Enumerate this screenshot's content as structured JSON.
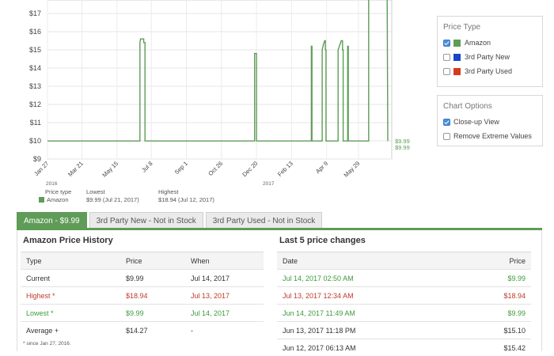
{
  "chart_data": {
    "type": "line",
    "x_start": "2016-01-27",
    "ylim": [
      9,
      17
    ],
    "yticks": [
      "$9",
      "$10",
      "$11",
      "$12",
      "$13",
      "$14",
      "$15",
      "$16",
      "$17"
    ],
    "xticks": [
      {
        "label": "Jan 27",
        "date": "2016-01-27"
      },
      {
        "label": "Mar 21",
        "date": "2016-03-21"
      },
      {
        "label": "May 15",
        "date": "2016-05-15"
      },
      {
        "label": "Jul 8",
        "date": "2016-07-08"
      },
      {
        "label": "Sep 1",
        "date": "2016-09-01"
      },
      {
        "label": "Oct 26",
        "date": "2016-10-26"
      },
      {
        "label": "Dec 20",
        "date": "2016-12-20"
      },
      {
        "label": "Feb 13",
        "date": "2017-02-13"
      },
      {
        "label": "Apr 9",
        "date": "2017-04-09"
      },
      {
        "label": "May 29",
        "date": "2017-05-29"
      }
    ],
    "year_labels": [
      {
        "label": "2016",
        "date": "2016-01-27"
      },
      {
        "label": "2017",
        "date": "2017-01-01"
      }
    ],
    "series": [
      {
        "name": "Amazon",
        "color": "#5e9c57",
        "points": [
          [
            "2016-01-27",
            9.99
          ],
          [
            "2016-06-20",
            9.99
          ],
          [
            "2016-06-20",
            15.4
          ],
          [
            "2016-06-21",
            15.6
          ],
          [
            "2016-06-26",
            15.6
          ],
          [
            "2016-06-26",
            15.4
          ],
          [
            "2016-06-28",
            15.4
          ],
          [
            "2016-06-28",
            9.99
          ],
          [
            "2016-12-17",
            9.99
          ],
          [
            "2016-12-17",
            14.8
          ],
          [
            "2016-12-20",
            14.8
          ],
          [
            "2016-12-20",
            9.99
          ],
          [
            "2017-03-16",
            9.99
          ],
          [
            "2017-03-16",
            15.2
          ],
          [
            "2017-03-17",
            15.2
          ],
          [
            "2017-03-17",
            9.99
          ],
          [
            "2017-04-02",
            9.99
          ],
          [
            "2017-04-02",
            15.0
          ],
          [
            "2017-04-04",
            15.3
          ],
          [
            "2017-04-06",
            15.5
          ],
          [
            "2017-04-07",
            15.5
          ],
          [
            "2017-04-07",
            15.0
          ],
          [
            "2017-04-08",
            15.0
          ],
          [
            "2017-04-08",
            9.99
          ],
          [
            "2017-04-27",
            9.99
          ],
          [
            "2017-04-27",
            15.0
          ],
          [
            "2017-04-29",
            15.2
          ],
          [
            "2017-05-02",
            15.5
          ],
          [
            "2017-05-04",
            15.5
          ],
          [
            "2017-05-04",
            15.0
          ],
          [
            "2017-05-05",
            15.0
          ],
          [
            "2017-05-05",
            9.99
          ],
          [
            "2017-05-12",
            9.99
          ],
          [
            "2017-05-12",
            15.2
          ],
          [
            "2017-05-13",
            15.2
          ],
          [
            "2017-05-13",
            9.99
          ],
          [
            "2017-06-14",
            9.99
          ],
          [
            "2017-06-14",
            18.94
          ],
          [
            "2017-07-13",
            18.94
          ],
          [
            "2017-07-14",
            9.99
          ],
          [
            "2017-07-14",
            9.99
          ]
        ]
      }
    ],
    "end_labels": [
      "$9.99",
      "$9.99"
    ]
  },
  "price_type": {
    "title": "Price Type",
    "options": [
      {
        "label": "Amazon",
        "checked": true,
        "color": "#5e9c57"
      },
      {
        "label": "3rd Party New",
        "checked": false,
        "color": "#1a44c8"
      },
      {
        "label": "3rd Party Used",
        "checked": false,
        "color": "#d83a1e"
      }
    ]
  },
  "chart_options": {
    "title": "Chart Options",
    "options": [
      {
        "label": "Close-up View",
        "checked": true
      },
      {
        "label": "Remove Extreme Values",
        "checked": false
      }
    ]
  },
  "price_table": {
    "col_type": "Price type",
    "col_lowest": "Lowest",
    "col_highest": "Highest",
    "series": "Amazon",
    "lowest": "$9.99 (Jul 21, 2017)",
    "highest": "$18.94 (Jul 12, 2017)"
  },
  "tabs": [
    "Amazon - $9.99",
    "3rd Party New - Not in Stock",
    "3rd Party Used - Not in Stock"
  ],
  "history": {
    "title": "Amazon Price History",
    "headers": [
      "Type",
      "Price",
      "When"
    ],
    "rows": [
      [
        "Current",
        "$9.99",
        "Jul 14, 2017"
      ],
      [
        "Highest *",
        "$18.94",
        "Jul 13, 2017"
      ],
      [
        "Lowest *",
        "$9.99",
        "Jul 14, 2017"
      ],
      [
        "Average +",
        "$14.27",
        "-"
      ]
    ]
  },
  "changes": {
    "title": "Last 5 price changes",
    "headers": [
      "Date",
      "Price"
    ],
    "rows": [
      [
        "Jul 14, 2017 02:50 AM",
        "$9.99"
      ],
      [
        "Jul 13, 2017 12:34 AM",
        "$18.94"
      ],
      [
        "Jun 14, 2017 11:49 AM",
        "$9.99"
      ],
      [
        "Jun 13, 2017 11:18 PM",
        "$15.10"
      ],
      [
        "Jun 12, 2017 06:13 AM",
        "$15.42"
      ]
    ]
  },
  "footnote": "* since Jan 27, 2016."
}
